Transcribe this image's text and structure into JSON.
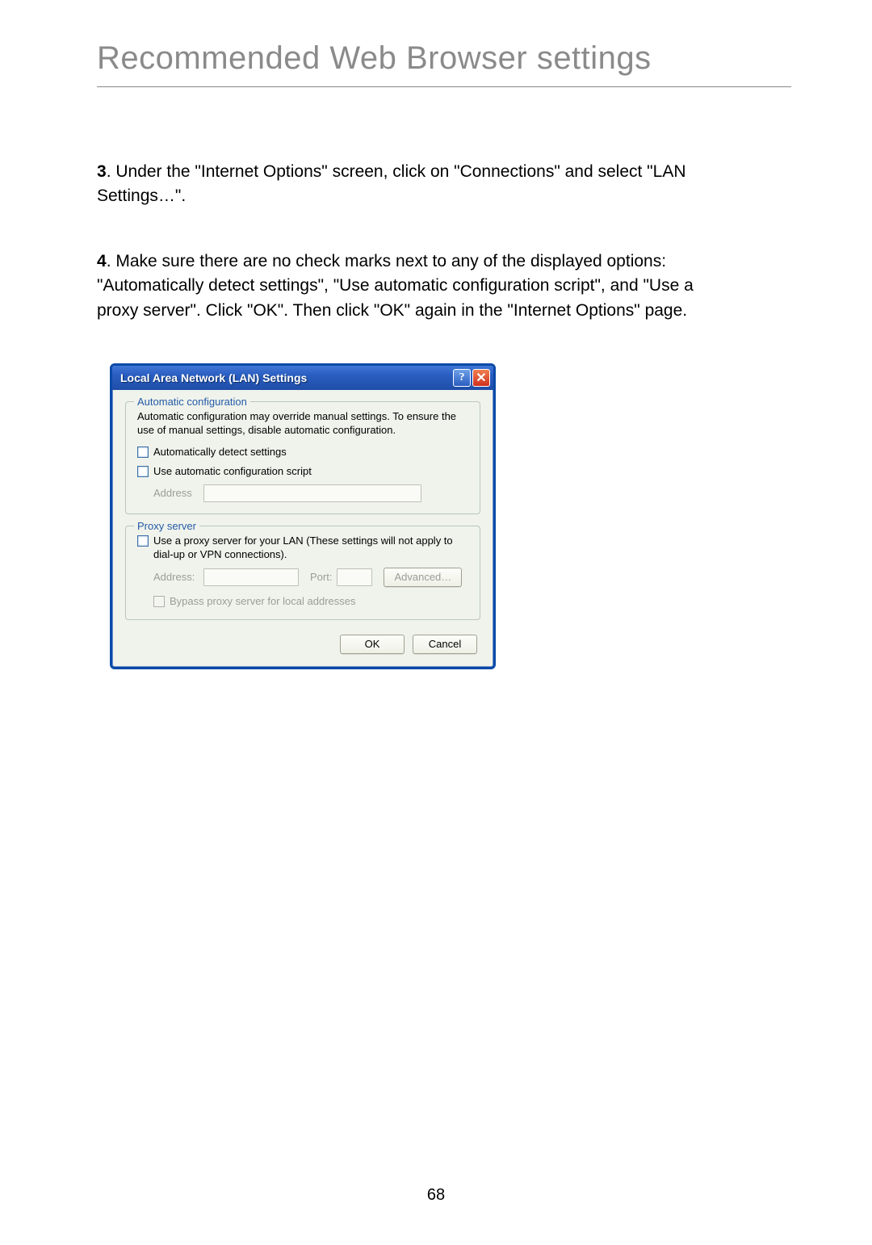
{
  "page": {
    "title": "Recommended Web Browser settings",
    "number": "68",
    "steps": {
      "s3": {
        "num": "3",
        "text": ". Under the \"Internet Options\" screen, click on \"Connections\" and select \"LAN Settings…\"."
      },
      "s4": {
        "num": "4",
        "text": ". Make sure there are no check marks next to any of the displayed options: \"Automatically detect settings\", \"Use automatic configuration script\", and \"Use a proxy server\". Click \"OK\". Then click \"OK\" again in the \"Internet Options\" page."
      }
    }
  },
  "dialog": {
    "title": "Local Area Network (LAN) Settings",
    "help_glyph": "?",
    "close_glyph": "✕",
    "group_autoconf": {
      "legend": "Automatic configuration",
      "desc": "Automatic configuration may override manual settings.  To ensure the use of manual settings, disable automatic configuration.",
      "cb_detect": "Automatically detect settings",
      "cb_script": "Use automatic configuration script",
      "address_label": "Address"
    },
    "group_proxy": {
      "legend": "Proxy server",
      "cb_use_proxy": "Use a proxy server for your LAN (These settings will not apply to dial-up or VPN connections).",
      "address_label": "Address:",
      "port_label": "Port:",
      "advanced_label": "Advanced…",
      "cb_bypass": "Bypass proxy server for local addresses"
    },
    "buttons": {
      "ok": "OK",
      "cancel": "Cancel"
    }
  }
}
